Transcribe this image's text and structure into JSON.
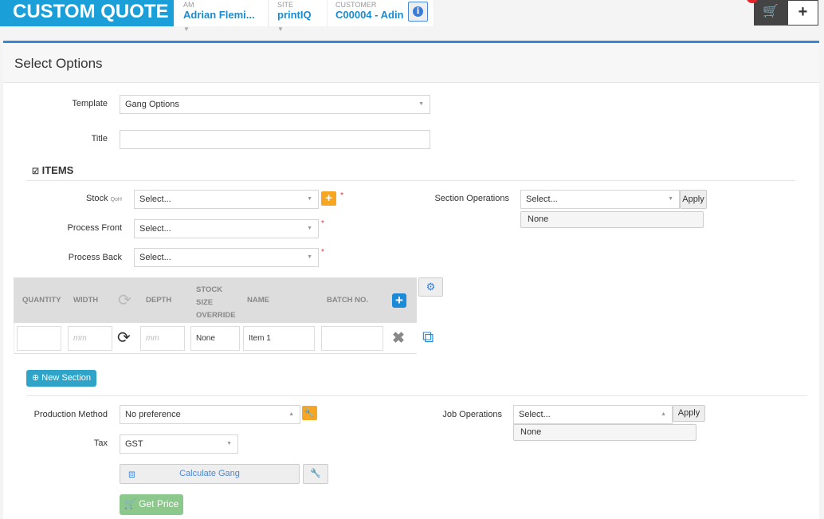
{
  "header": {
    "brand": "CUSTOM QUOTE",
    "am_label": "AM",
    "am_value": "Adrian Flemi...",
    "site_label": "SITE",
    "site_value": "printIQ",
    "customer_label": "CUSTOMER",
    "customer_value": "C00004 - Adin",
    "info": "i",
    "cart": "🛒",
    "add": "+"
  },
  "page": {
    "title": "Select Options"
  },
  "form": {
    "template_label": "Template",
    "template_value": "Gang Options",
    "title_label": "Title",
    "title_value": ""
  },
  "items": {
    "heading": "ITEMS",
    "stock_label": "Stock",
    "stock_sub": "QoH",
    "stock_value": "Select...",
    "process_front_label": "Process Front",
    "process_front_value": "Select...",
    "process_back_label": "Process Back",
    "process_back_value": "Select...",
    "required": "*",
    "add": "+",
    "section_ops_label": "Section Operations",
    "section_ops_value": "Select...",
    "apply": "Apply",
    "section_ops_selected": "None"
  },
  "table": {
    "headers": [
      "QUANTITY",
      "WIDTH",
      "DEPTH",
      "STOCK SIZE OVERRIDE",
      "NAME",
      "BATCH NO."
    ],
    "row": {
      "quantity": "",
      "width_placeholder": "mm",
      "depth_placeholder": "mm",
      "stock_size": "None",
      "name": "Item 1",
      "batch": ""
    }
  },
  "new_section": "New Section",
  "job": {
    "production_label": "Production Method",
    "production_value": "No preference",
    "tax_label": "Tax",
    "tax_value": "GST",
    "calc": "Calculate Gang",
    "get_price": "Get Price",
    "job_ops_label": "Job Operations",
    "job_ops_value": "Select...",
    "apply": "Apply",
    "job_ops_selected": "None"
  },
  "colors": {
    "brand": "#1b9fd8",
    "accent": "#3a87d8",
    "orange": "#f5a623",
    "green": "#8cc78c"
  }
}
